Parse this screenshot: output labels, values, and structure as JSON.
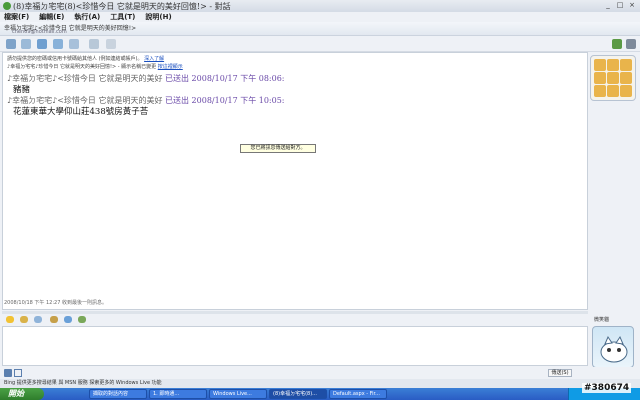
{
  "window": {
    "title": "(8)幸福ㄉ宅宅(8)<珍惜今日    它就是明天的美好回憶!> - 對話",
    "controls": [
      "_",
      "□",
      "×"
    ]
  },
  "menu": [
    "檔案(F)",
    "編輯(E)",
    "執行(A)",
    "工具(T)",
    "說明(H)"
  ],
  "contact": {
    "name": "幸福ㄉ宅宅♪<珍惜今日    它就是明天的美好回憶!>",
    "email": "chen69@hotmail.com"
  },
  "chat": {
    "sys_line1": "請勿提供您的密碼或信用卡號碼給其他人 (例如連結或帳戶)。",
    "sys_link": "深入了解",
    "sys_line2": "♪幸福ㄉ宅宅♪珍惜今日    它就是明天的美好回憶!> - 顯示名稱已變更",
    "sys_link2": "按這裡顯示",
    "messages": [
      {
        "sender": "♪幸福ㄉ宅宅♪<珍惜今日    它就是明天的美好",
        "note": "已送出 2008/10/17 下午 08:06:",
        "text": "豬豬"
      },
      {
        "sender": "♪幸福ㄉ宅宅♪<珍惜今日    它就是明天的美好",
        "note": "已送出 2008/10/17 下午 10:05:",
        "text": "花蓮東華大學仰山莊438號房黃子荅"
      }
    ],
    "tooltip": "您已將訊息傳送給對方。",
    "status": "2008/10/18 下午 12:27 收到最後一則訊息。"
  },
  "sidebar": {
    "friend_label": "微笑貓"
  },
  "input": {
    "send_label": "傳送(S)"
  },
  "adbar": "Bing 提供更多搜尋結果 與 MSN 服務 探索更多的 Windows Live 功能",
  "taskbar": {
    "start": "開始",
    "tasks": [
      {
        "label": "擷取的對話內容",
        "active": false
      },
      {
        "label": "1. 即時通...",
        "active": false
      },
      {
        "label": "Windows Live...",
        "active": false
      },
      {
        "label": "(8)幸福ㄉ宅宅(8)...",
        "active": true
      },
      {
        "label": "Default.aspx - Fir...",
        "active": false
      }
    ]
  },
  "watermark": "#380674",
  "colors": {
    "accent": "#1a4fbf",
    "taskbar": "#2a5cc4",
    "start": "#2f7d2c",
    "tooltip_bg": "#ffffe1"
  }
}
